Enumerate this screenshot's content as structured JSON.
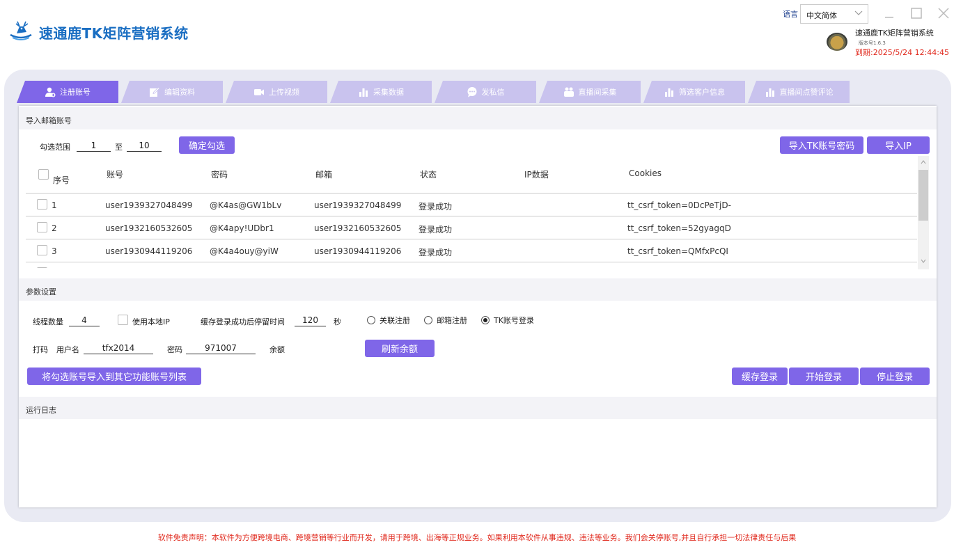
{
  "header": {
    "app_title": "速通鹿TK矩阵营销系统",
    "language_label": "语言",
    "language_value": "中文简体",
    "user_title": "速通鹿TK矩阵营销系统",
    "version": "版本号1.6.3",
    "expiry": "到期:2025/5/24 12:44:45"
  },
  "tabs": [
    {
      "label": "注册账号",
      "icon": "user-add-icon",
      "active": true
    },
    {
      "label": "编辑资料",
      "icon": "edit-icon",
      "active": false
    },
    {
      "label": "上传视频",
      "icon": "video-icon",
      "active": false
    },
    {
      "label": "采集数据",
      "icon": "bar-chart-icon",
      "active": false
    },
    {
      "label": "发私信",
      "icon": "chat-icon",
      "active": false
    },
    {
      "label": "直播间采集",
      "icon": "people-icon",
      "active": false
    },
    {
      "label": "筛选客户信息",
      "icon": "bar-chart-icon",
      "active": false
    },
    {
      "label": "直播间点赞评论",
      "icon": "bar-chart-icon",
      "active": false
    }
  ],
  "import_section": {
    "title": "导入邮箱账号",
    "range_label": "勾选范围",
    "range_from": "1",
    "range_to_label": "至",
    "range_to": "10",
    "confirm_button": "确定勾选",
    "import_tk_button": "导入TK账号密码",
    "import_ip_button": "导入IP"
  },
  "table": {
    "columns": [
      "序号",
      "账号",
      "密码",
      "邮箱",
      "状态",
      "IP数据",
      "Cookies"
    ],
    "rows": [
      {
        "index": "1",
        "account": "user1939327048499",
        "password": "@K4as@GW1bLv",
        "email": "user1939327048499",
        "status": "登录成功",
        "ip": "",
        "cookies": "tt_csrf_token=0DcPeTjD-"
      },
      {
        "index": "2",
        "account": "user1932160532605",
        "password": "@K4apy!UDbr1",
        "email": "user1932160532605",
        "status": "登录成功",
        "ip": "",
        "cookies": "tt_csrf_token=52gyagqD"
      },
      {
        "index": "3",
        "account": "user1930944119206",
        "password": "@K4a4ouy@yiW",
        "email": "user1930944119206",
        "status": "登录成功",
        "ip": "",
        "cookies": "tt_csrf_token=QMfxPcQI"
      }
    ]
  },
  "params": {
    "title": "参数设置",
    "thread_label": "线程数量",
    "thread_value": "4",
    "local_ip_label": "使用本地IP",
    "cache_wait_label": "缓存登录成功后停留时间",
    "cache_wait_value": "120",
    "seconds_label": "秒",
    "radio_options": [
      {
        "label": "关联注册",
        "selected": false
      },
      {
        "label": "邮箱注册",
        "selected": false
      },
      {
        "label": "TK账号登录",
        "selected": true
      }
    ],
    "captcha_label": "打码",
    "username_label": "用户名",
    "username_value": "tfx2014",
    "password_label": "密码",
    "password_value": "971007",
    "balance_label": "余额",
    "refresh_button": "刷新余额",
    "export_button": "将勾选账号导入到其它功能账号列表",
    "cache_login_button": "缓存登录",
    "start_login_button": "开始登录",
    "stop_login_button": "停止登录"
  },
  "log": {
    "title": "运行日志"
  },
  "footer": {
    "disclaimer": "软件免责声明：本软件为方便跨境电商、跨境营销等行业而开发，请用于跨境、出海等正规业务。如果利用本软件从事违规、违法等业务。我们会关停账号,并且自行承担一切法律责任与后果"
  },
  "colors": {
    "accent": "#7f66e8",
    "tab_inactive": "#c9c3ee",
    "title_blue": "#1a6ec2",
    "warning_red": "#e0281c"
  }
}
